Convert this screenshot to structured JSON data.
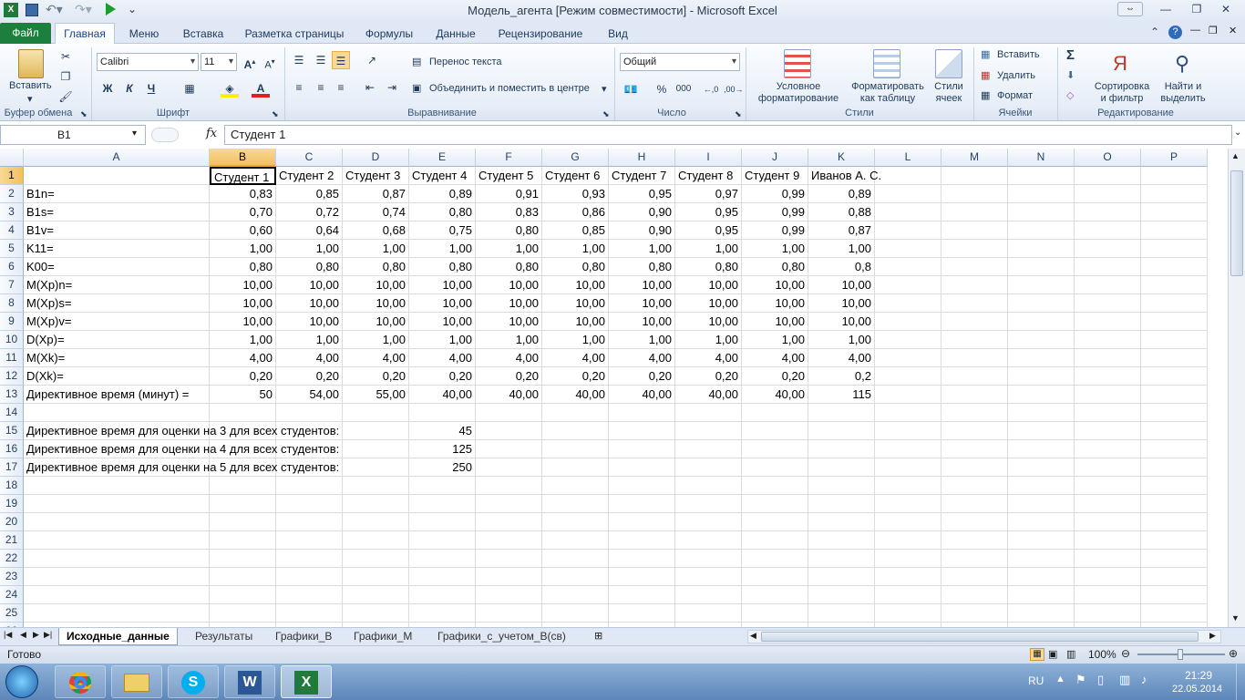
{
  "window": {
    "title": "Модель_агента  [Режим совместимости]  -  Microsoft Excel"
  },
  "tabs": [
    "Файл",
    "Главная",
    "Меню",
    "Вставка",
    "Разметка страницы",
    "Формулы",
    "Данные",
    "Рецензирование",
    "Вид"
  ],
  "ribbon": {
    "clipboard": {
      "paste": "Вставить",
      "group": "Буфер обмена"
    },
    "font": {
      "name": "Calibri",
      "size": "11",
      "bold": "Ж",
      "italic": "К",
      "underline": "Ч",
      "group": "Шрифт"
    },
    "alignment": {
      "wrap": "Перенос текста",
      "merge": "Объединить и поместить в центре",
      "group": "Выравнивание"
    },
    "number": {
      "format": "Общий",
      "percent": "%",
      "thousands": "000",
      "group": "Число"
    },
    "styles": {
      "conditional": "Условное форматирование",
      "table": "Форматировать как таблицу",
      "cellstyles": "Стили ячеек",
      "group": "Стили"
    },
    "cells": {
      "insert": "Вставить",
      "delete": "Удалить",
      "format": "Формат",
      "group": "Ячейки"
    },
    "editing": {
      "sum": "Σ",
      "sort": "Сортировка и фильтр",
      "find": "Найти и выделить",
      "group": "Редактирование"
    }
  },
  "formula_bar": {
    "name_box": "B1",
    "fx": "fx",
    "content": "Студент 1"
  },
  "columns": [
    {
      "name": "A",
      "w": 0
    },
    {
      "name": "B"
    },
    {
      "name": "C"
    },
    {
      "name": "D"
    },
    {
      "name": "E"
    },
    {
      "name": "F"
    },
    {
      "name": "G"
    },
    {
      "name": "H"
    },
    {
      "name": "I"
    },
    {
      "name": "J"
    },
    {
      "name": "K"
    },
    {
      "name": "L"
    },
    {
      "name": "M"
    },
    {
      "name": "N"
    },
    {
      "name": "O"
    },
    {
      "name": "P"
    }
  ],
  "rows": [
    [
      "",
      "Студент 1",
      "Студент 2",
      "Студент 3",
      "Студент 4",
      "Студент 5",
      "Студент 6",
      "Студент 7",
      "Студент 8",
      "Студент 9",
      "Иванов А. С."
    ],
    [
      "B1n=",
      "0,83",
      "0,85",
      "0,87",
      "0,89",
      "0,91",
      "0,93",
      "0,95",
      "0,97",
      "0,99",
      "0,89"
    ],
    [
      "B1s=",
      "0,70",
      "0,72",
      "0,74",
      "0,80",
      "0,83",
      "0,86",
      "0,90",
      "0,95",
      "0,99",
      "0,88"
    ],
    [
      "B1v=",
      "0,60",
      "0,64",
      "0,68",
      "0,75",
      "0,80",
      "0,85",
      "0,90",
      "0,95",
      "0,99",
      "0,87"
    ],
    [
      "K11=",
      "1,00",
      "1,00",
      "1,00",
      "1,00",
      "1,00",
      "1,00",
      "1,00",
      "1,00",
      "1,00",
      "1,00"
    ],
    [
      "K00=",
      "0,80",
      "0,80",
      "0,80",
      "0,80",
      "0,80",
      "0,80",
      "0,80",
      "0,80",
      "0,80",
      "0,8"
    ],
    [
      "M(Xp)n=",
      "10,00",
      "10,00",
      "10,00",
      "10,00",
      "10,00",
      "10,00",
      "10,00",
      "10,00",
      "10,00",
      "10,00"
    ],
    [
      "M(Xp)s=",
      "10,00",
      "10,00",
      "10,00",
      "10,00",
      "10,00",
      "10,00",
      "10,00",
      "10,00",
      "10,00",
      "10,00"
    ],
    [
      "M(Xp)v=",
      "10,00",
      "10,00",
      "10,00",
      "10,00",
      "10,00",
      "10,00",
      "10,00",
      "10,00",
      "10,00",
      "10,00"
    ],
    [
      "D(Xp)=",
      "1,00",
      "1,00",
      "1,00",
      "1,00",
      "1,00",
      "1,00",
      "1,00",
      "1,00",
      "1,00",
      "1,00"
    ],
    [
      "M(Xk)=",
      "4,00",
      "4,00",
      "4,00",
      "4,00",
      "4,00",
      "4,00",
      "4,00",
      "4,00",
      "4,00",
      "4,00"
    ],
    [
      "D(Xk)=",
      "0,20",
      "0,20",
      "0,20",
      "0,20",
      "0,20",
      "0,20",
      "0,20",
      "0,20",
      "0,20",
      "0,2"
    ],
    [
      "Директивное время (минут) =",
      "50",
      "54,00",
      "55,00",
      "40,00",
      "40,00",
      "40,00",
      "40,00",
      "40,00",
      "40,00",
      "115"
    ],
    [],
    [
      "Директивное время для оценки на 3 для всех студентов:",
      "",
      "",
      "",
      "45"
    ],
    [
      "Директивное время для оценки на 4 для всех студентов:",
      "",
      "",
      "",
      "125"
    ],
    [
      "Директивное время для оценки на 5 для всех студентов:",
      "",
      "",
      "",
      "250"
    ],
    [],
    [],
    [],
    [],
    [],
    [],
    [],
    [],
    []
  ],
  "sheets": [
    "Исходные_данные",
    "Результаты",
    "Графики_В",
    "Графики_М",
    "Графики_с_учетом_В(св)"
  ],
  "status": {
    "ready": "Готово",
    "zoom": "100%"
  },
  "taskbar": {
    "lang": "RU",
    "time": "21:29",
    "date": "22.05.2014"
  }
}
